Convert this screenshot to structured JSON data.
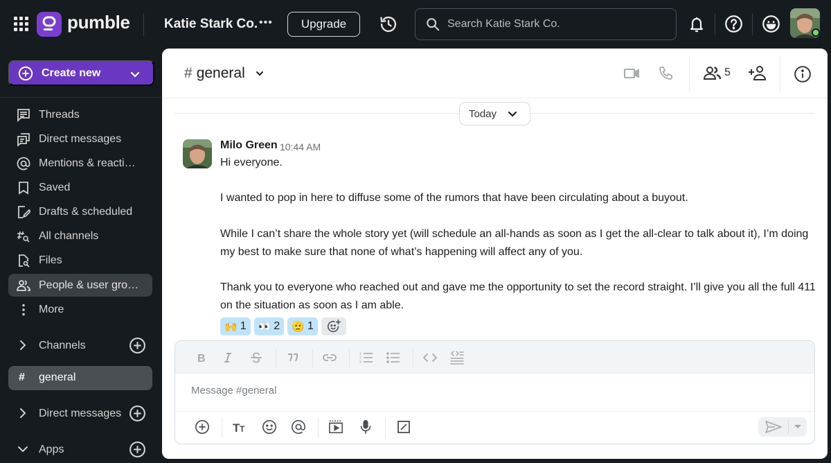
{
  "topbar": {
    "brand": "pumble",
    "workspace": "Katie Stark Co.",
    "workspace_more": "•••",
    "upgrade_label": "Upgrade",
    "search_placeholder": "Search Katie Stark Co.",
    "user_status": "online"
  },
  "sidebar": {
    "create_new_label": "Create new",
    "nav": [
      {
        "label": "Threads",
        "icon": "threads-icon"
      },
      {
        "label": "Direct messages",
        "icon": "direct-messages-icon"
      },
      {
        "label": "Mentions & reacti…",
        "icon": "mention-icon"
      },
      {
        "label": "Saved",
        "icon": "bookmark-icon"
      },
      {
        "label": "Drafts & scheduled",
        "icon": "draft-icon"
      },
      {
        "label": "All channels",
        "icon": "channel-search-icon"
      },
      {
        "label": "Files",
        "icon": "file-search-icon"
      },
      {
        "label": "People & user gro…",
        "icon": "people-icon",
        "active": true
      },
      {
        "label": "More",
        "icon": "more-vertical-icon"
      }
    ],
    "sections": {
      "channels": "Channels",
      "direct_messages": "Direct messages",
      "apps": "Apps"
    },
    "channels": [
      {
        "label": "general",
        "prefix": "#",
        "active": true
      }
    ]
  },
  "channel": {
    "hash": "#",
    "name": "general",
    "member_count": "5"
  },
  "day_divider": "Today",
  "message": {
    "author": "Milo Green",
    "time": "10:44 AM",
    "lines": [
      "Hi everyone.",
      "I wanted to pop in here to diffuse some of the rumors that have been circulating about a buyout.",
      "While I can’t share the whole story yet (will schedule an all-hands as soon as I get the all-clear to talk about it), I’m doing my best to make sure that none of what’s happening will affect any of you.",
      "Thank you to everyone who reached out and gave me the opportunity to set the record straight. I’ll give you all the full 411 on the situation as soon as I am able."
    ],
    "reactions": [
      {
        "emoji": "🙌",
        "name": "raised-hands",
        "count": "1"
      },
      {
        "emoji": "👀",
        "name": "eyes",
        "count": "2"
      },
      {
        "emoji": "🫡",
        "name": "saluting-face",
        "count": "1"
      }
    ]
  },
  "composer": {
    "placeholder": "Message #general"
  }
}
